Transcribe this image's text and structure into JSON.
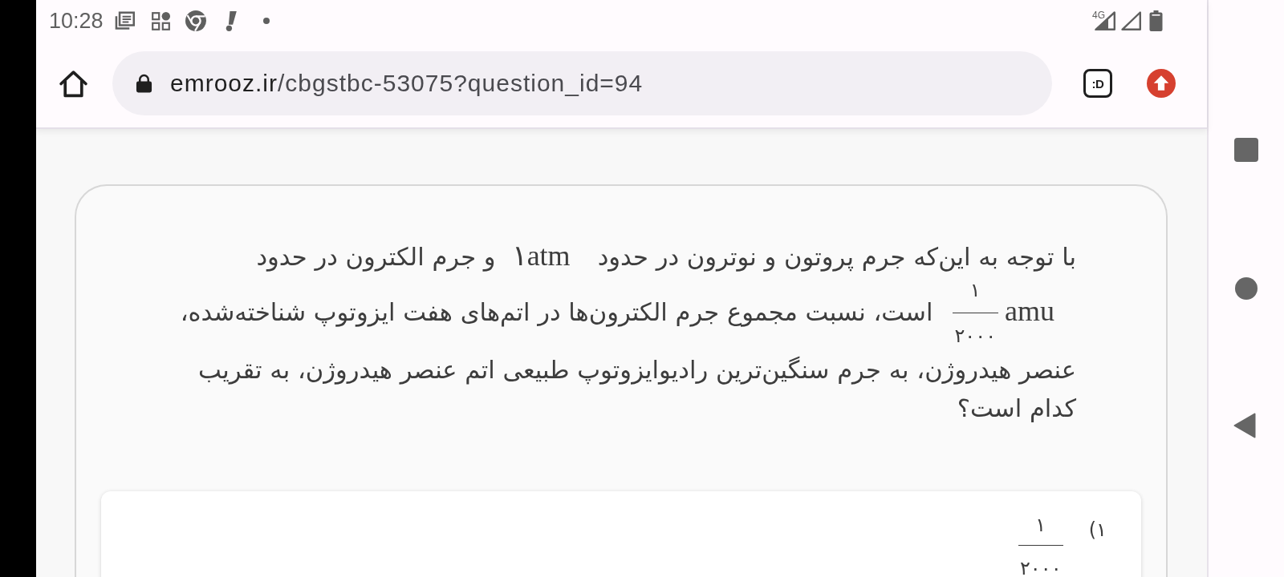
{
  "status_bar": {
    "time": "10:28",
    "network": "4G"
  },
  "toolbar": {
    "url_host": "emrooz.ir",
    "url_path": "/cbgstbc-53075?question_id=94",
    "tab_count": ":D"
  },
  "question": {
    "lines": [
      [
        {
          "kind": "text",
          "text": "با توجه به این‌که جرم پروتون و نوترون در حدود"
        },
        {
          "kind": "math",
          "text": "۱atm"
        },
        {
          "kind": "text",
          "text": "و جرم الکترون در حدود"
        }
      ],
      [
        {
          "kind": "quantity",
          "numerator": "۱",
          "denominator": "۲۰۰۰",
          "unit": "amu"
        },
        {
          "kind": "text",
          "text": "است، نسبت مجموع جرم الکترون‌ها در اتم‌های هفت ایزوتوپ شناخته‌شده،"
        }
      ],
      [
        {
          "kind": "text",
          "text": "عنصر هیدروژن، به جرم سنگین‌ترین رادیوایزوتوپ طبیعی اتم عنصر هیدروژن، به تقریب"
        }
      ],
      [
        {
          "kind": "text",
          "text": "کدام است؟"
        }
      ]
    ]
  },
  "options": [
    {
      "number": "۱)",
      "numerator": "۱",
      "denominator": "۲۰۰۰"
    }
  ]
}
